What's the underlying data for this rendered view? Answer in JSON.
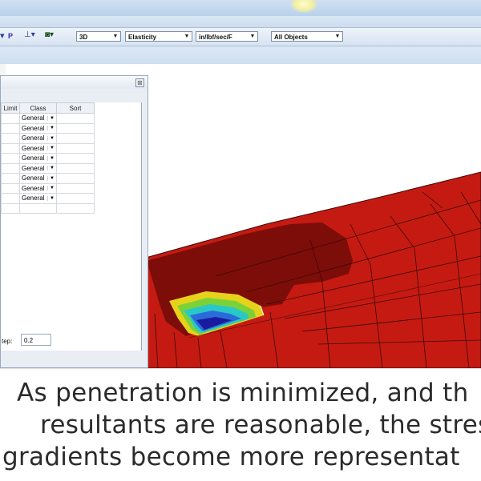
{
  "toolbar": {
    "icons": [
      "dropdown-arrow-icon",
      "p-icon",
      "node-icon",
      "camera-icon"
    ],
    "p_label": "P",
    "view_mode": "3D",
    "analysis_type": "Elasticity",
    "units": "in/lbf/sec/F",
    "object_filter": "All Objects"
  },
  "dialog": {
    "columns": [
      "Limit",
      "Class",
      "Sort"
    ],
    "rows": [
      {
        "class": "General"
      },
      {
        "class": "General"
      },
      {
        "class": "General"
      },
      {
        "class": "General"
      },
      {
        "class": "General"
      },
      {
        "class": "General"
      },
      {
        "class": "General"
      },
      {
        "class": "General"
      },
      {
        "class": "General"
      }
    ],
    "step_label": "tep:",
    "step_value": "0.2",
    "close_glyph": "⊠"
  },
  "caption": {
    "line1": "As penetration is minimized, and th",
    "line2": "resultants are reasonable, the stres",
    "line3": "gradients become more representat"
  },
  "colors": {
    "model_red": "#c51a12",
    "shadow_red": "#7d0d08",
    "mesh_line": "#3a0a08"
  }
}
